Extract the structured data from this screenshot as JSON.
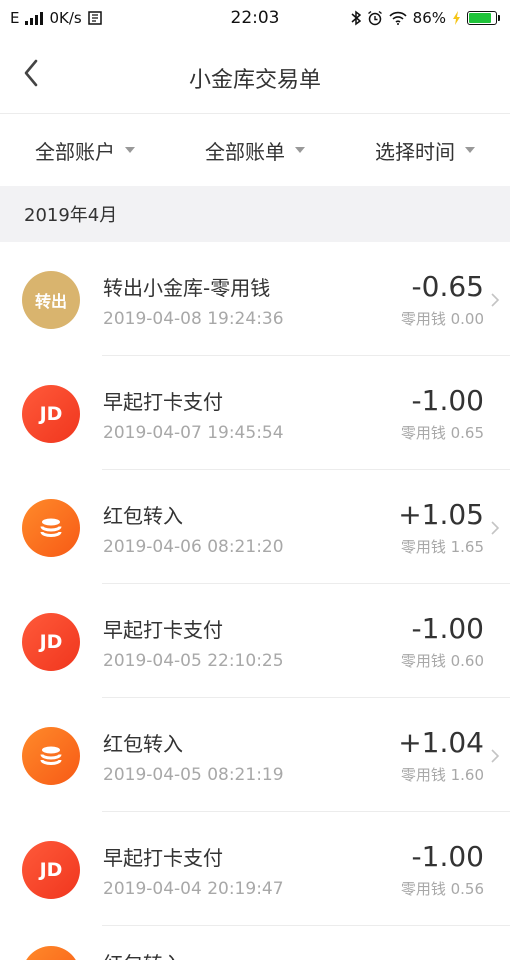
{
  "status_bar": {
    "carrier": "E",
    "speed": "0K/s",
    "time": "22:03",
    "battery": "86%"
  },
  "nav": {
    "title": "小金库交易单"
  },
  "filters": [
    {
      "label": "全部账户"
    },
    {
      "label": "全部账单"
    },
    {
      "label": "选择时间"
    }
  ],
  "month": "2019年4月",
  "transactions": [
    {
      "icon": "transfer-out-badge",
      "icon_text": "转出",
      "title": "转出小金库-零用钱",
      "time": "2019-04-08  19:24:36",
      "amount": "-0.65",
      "balance": "零用钱 0.00",
      "has_chevron": true
    },
    {
      "icon": "jd-badge",
      "icon_text": "JD",
      "title": "早起打卡支付",
      "time": "2019-04-07  19:45:54",
      "amount": "-1.00",
      "balance": "零用钱 0.65",
      "has_chevron": false
    },
    {
      "icon": "coins-icon",
      "icon_text": "",
      "title": "红包转入",
      "time": "2019-04-06  08:21:20",
      "amount": "+1.05",
      "balance": "零用钱 1.65",
      "has_chevron": true
    },
    {
      "icon": "jd-badge",
      "icon_text": "JD",
      "title": "早起打卡支付",
      "time": "2019-04-05  22:10:25",
      "amount": "-1.00",
      "balance": "零用钱 0.60",
      "has_chevron": false
    },
    {
      "icon": "coins-icon",
      "icon_text": "",
      "title": "红包转入",
      "time": "2019-04-05  08:21:19",
      "amount": "+1.04",
      "balance": "零用钱 1.60",
      "has_chevron": true
    },
    {
      "icon": "jd-badge",
      "icon_text": "JD",
      "title": "早起打卡支付",
      "time": "2019-04-04  20:19:47",
      "amount": "-1.00",
      "balance": "零用钱 0.56",
      "has_chevron": false
    },
    {
      "icon": "coins-icon",
      "icon_text": "",
      "title": "红包转入",
      "time": "",
      "amount": "",
      "balance": "",
      "has_chevron": false
    }
  ],
  "colors": {
    "gold_badge": "#d9b46e",
    "jd_red": "#f0361e",
    "coin_orange": "#f75a16",
    "battery_green": "#1fc33a"
  }
}
